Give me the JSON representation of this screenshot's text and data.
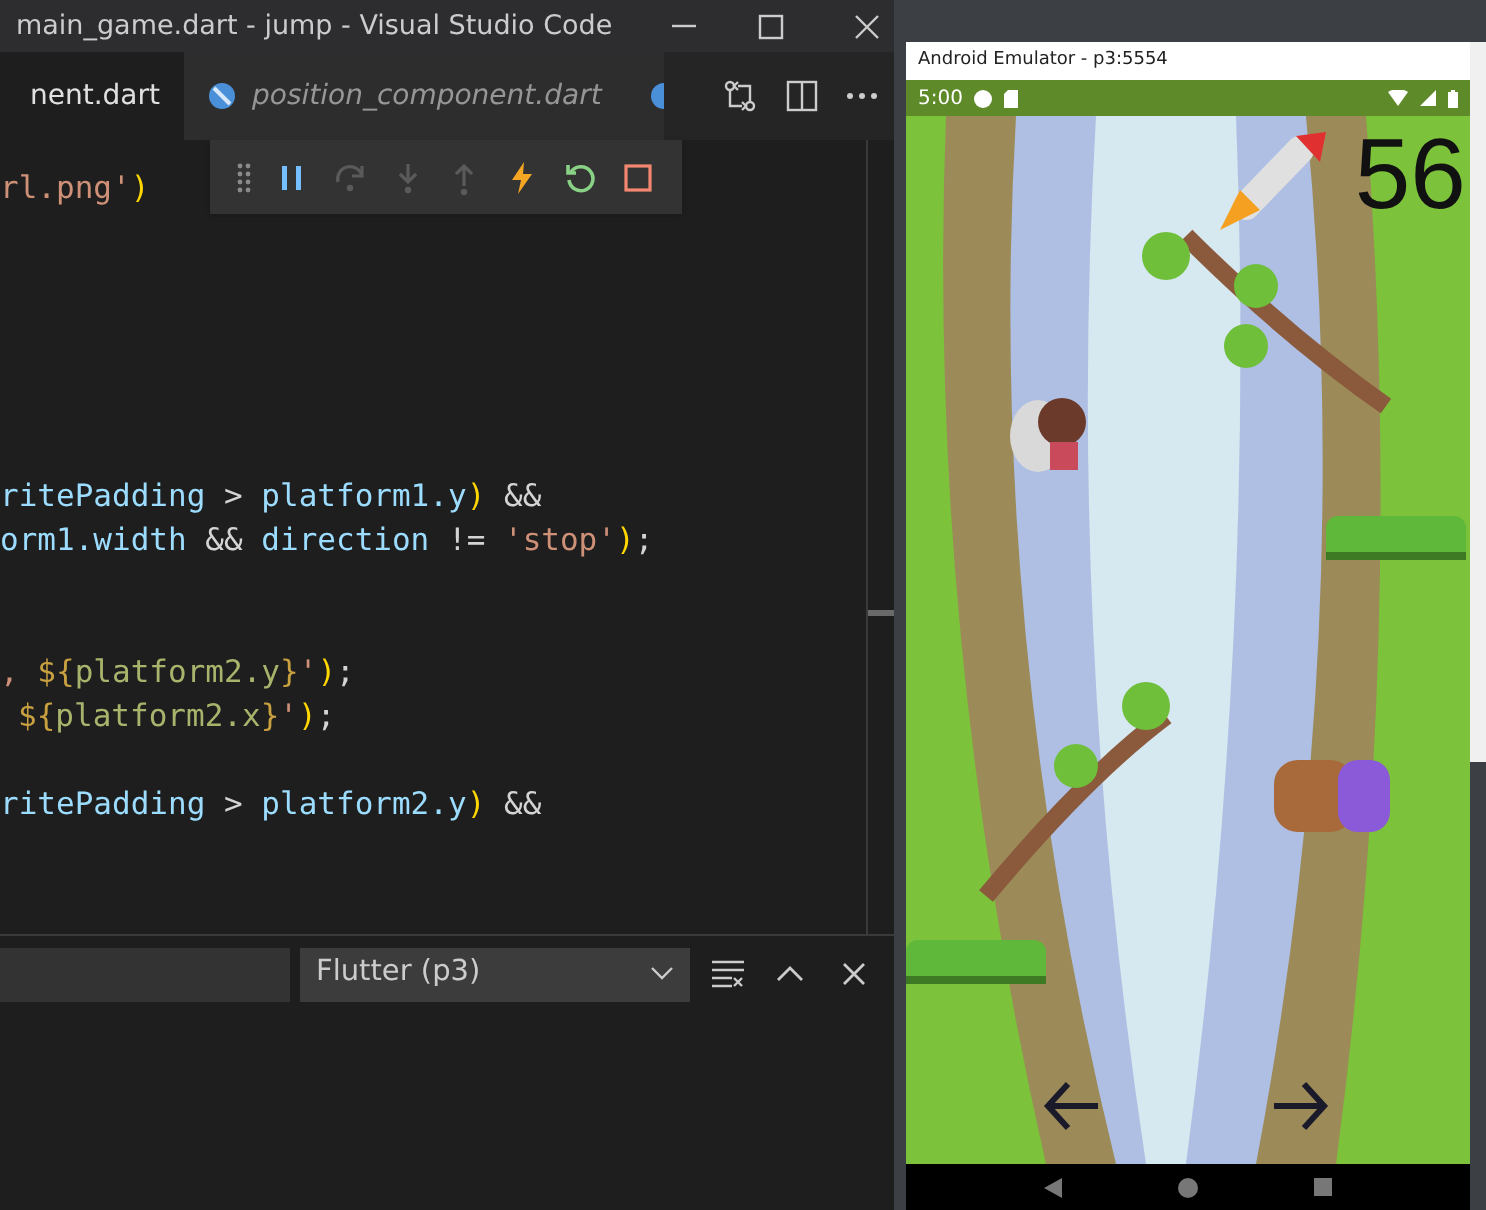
{
  "window": {
    "title": "main_game.dart - jump - Visual Studio Code"
  },
  "tabs": [
    {
      "label": "nent.dart",
      "selected": true,
      "preview": false
    },
    {
      "label": "position_component.dart",
      "selected": false,
      "preview": true
    }
  ],
  "debug_toolbar": [
    {
      "kind": "grip",
      "disabled": false
    },
    {
      "kind": "pause",
      "disabled": false
    },
    {
      "kind": "step-over",
      "disabled": true
    },
    {
      "kind": "step-into",
      "disabled": true
    },
    {
      "kind": "step-out",
      "disabled": true
    },
    {
      "kind": "hot-reload",
      "disabled": false
    },
    {
      "kind": "restart",
      "disabled": false
    },
    {
      "kind": "stop",
      "disabled": false
    }
  ],
  "code_lines": [
    {
      "kind": "code",
      "segments": [
        {
          "text": "rl.png'",
          "kind": "string"
        },
        {
          "text": ")",
          "kind": "bracket"
        }
      ]
    },
    {
      "kind": "blank"
    },
    {
      "kind": "blank"
    },
    {
      "kind": "blank"
    },
    {
      "kind": "blank"
    },
    {
      "kind": "blank"
    },
    {
      "kind": "blank"
    },
    {
      "kind": "code",
      "segments": [
        {
          "text": "ritePadding",
          "kind": "var"
        },
        {
          "text": " > ",
          "kind": "op"
        },
        {
          "text": "platform1.y",
          "kind": "var"
        },
        {
          "text": ")",
          "kind": "bracket"
        },
        {
          "text": " &&",
          "kind": "op"
        }
      ]
    },
    {
      "kind": "code",
      "segments": [
        {
          "text": "orm1.width",
          "kind": "var"
        },
        {
          "text": " && ",
          "kind": "op"
        },
        {
          "text": "direction",
          "kind": "var"
        },
        {
          "text": " != ",
          "kind": "op"
        },
        {
          "text": "'stop'",
          "kind": "string"
        },
        {
          "text": ")",
          "kind": "bracket"
        },
        {
          "text": ";",
          "kind": "op"
        }
      ]
    },
    {
      "kind": "blank"
    },
    {
      "kind": "blank"
    },
    {
      "kind": "code",
      "segments": [
        {
          "text": ", ",
          "kind": "string"
        },
        {
          "text": "${",
          "kind": "interp"
        },
        {
          "text": "platform2.y",
          "kind": "interpvar"
        },
        {
          "text": "}",
          "kind": "interp"
        },
        {
          "text": "'",
          "kind": "string"
        },
        {
          "text": ")",
          "kind": "bracket"
        },
        {
          "text": ";",
          "kind": "op"
        }
      ]
    },
    {
      "kind": "code",
      "segments": [
        {
          "text": "${",
          "kind": "interp"
        },
        {
          "text": "platform2.x",
          "kind": "interpvar"
        },
        {
          "text": "}",
          "kind": "interp"
        },
        {
          "text": "'",
          "kind": "string"
        },
        {
          "text": ")",
          "kind": "bracket"
        },
        {
          "text": ";",
          "kind": "op"
        }
      ]
    },
    {
      "kind": "blank"
    },
    {
      "kind": "code",
      "segments": [
        {
          "text": "ritePadding",
          "kind": "var"
        },
        {
          "text": " > ",
          "kind": "op"
        },
        {
          "text": "platform2.y",
          "kind": "var"
        },
        {
          "text": ")",
          "kind": "bracket"
        },
        {
          "text": " &&",
          "kind": "op"
        }
      ]
    }
  ],
  "panel": {
    "output_channel": "Flutter (p3)"
  },
  "emulator": {
    "title": "Android Emulator - p3:5554",
    "time": "5:00",
    "score": "56"
  }
}
